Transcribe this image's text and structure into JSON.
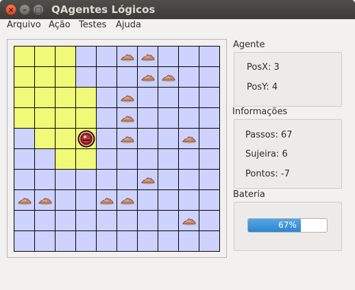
{
  "window": {
    "title": "QAgentes Lógicos"
  },
  "menu": [
    "Arquivo",
    "Ação",
    "Testes",
    "Ajuda"
  ],
  "colors": {
    "cell": "#cdd2ff",
    "visited": "#f0fa78",
    "grid_line": "#000000",
    "agent": "#8b1a1a",
    "progress": "#2d86d0"
  },
  "grid": {
    "size": 10,
    "visited": [
      [
        0,
        0
      ],
      [
        1,
        0
      ],
      [
        2,
        0
      ],
      [
        0,
        1
      ],
      [
        1,
        1
      ],
      [
        2,
        1
      ],
      [
        0,
        2
      ],
      [
        1,
        2
      ],
      [
        2,
        2
      ],
      [
        3,
        2
      ],
      [
        0,
        3
      ],
      [
        1,
        3
      ],
      [
        2,
        3
      ],
      [
        3,
        3
      ],
      [
        1,
        4
      ],
      [
        2,
        4
      ],
      [
        3,
        4
      ],
      [
        2,
        5
      ],
      [
        3,
        5
      ]
    ],
    "dirt": [
      [
        5,
        0
      ],
      [
        6,
        0
      ],
      [
        6,
        1
      ],
      [
        7,
        1
      ],
      [
        5,
        2
      ],
      [
        5,
        3
      ],
      [
        5,
        4
      ],
      [
        8,
        4
      ],
      [
        6,
        6
      ],
      [
        0,
        7
      ],
      [
        1,
        7
      ],
      [
        4,
        7
      ],
      [
        5,
        7
      ],
      [
        8,
        8
      ]
    ],
    "agent": [
      3,
      4
    ],
    "icons": {
      "dirt": "dirt-pile-icon",
      "agent": "robot-agent-icon"
    }
  },
  "agent_panel": {
    "label": "Agente",
    "posx": "PosX: 3",
    "posy": "PosY: 4"
  },
  "info_panel": {
    "label": "Informações",
    "passos": "Passos: 67",
    "sujeira": "Sujeira: 6",
    "pontos": "Pontos: -7"
  },
  "battery": {
    "label": "Bateria",
    "percent": 67,
    "text": "67%"
  }
}
